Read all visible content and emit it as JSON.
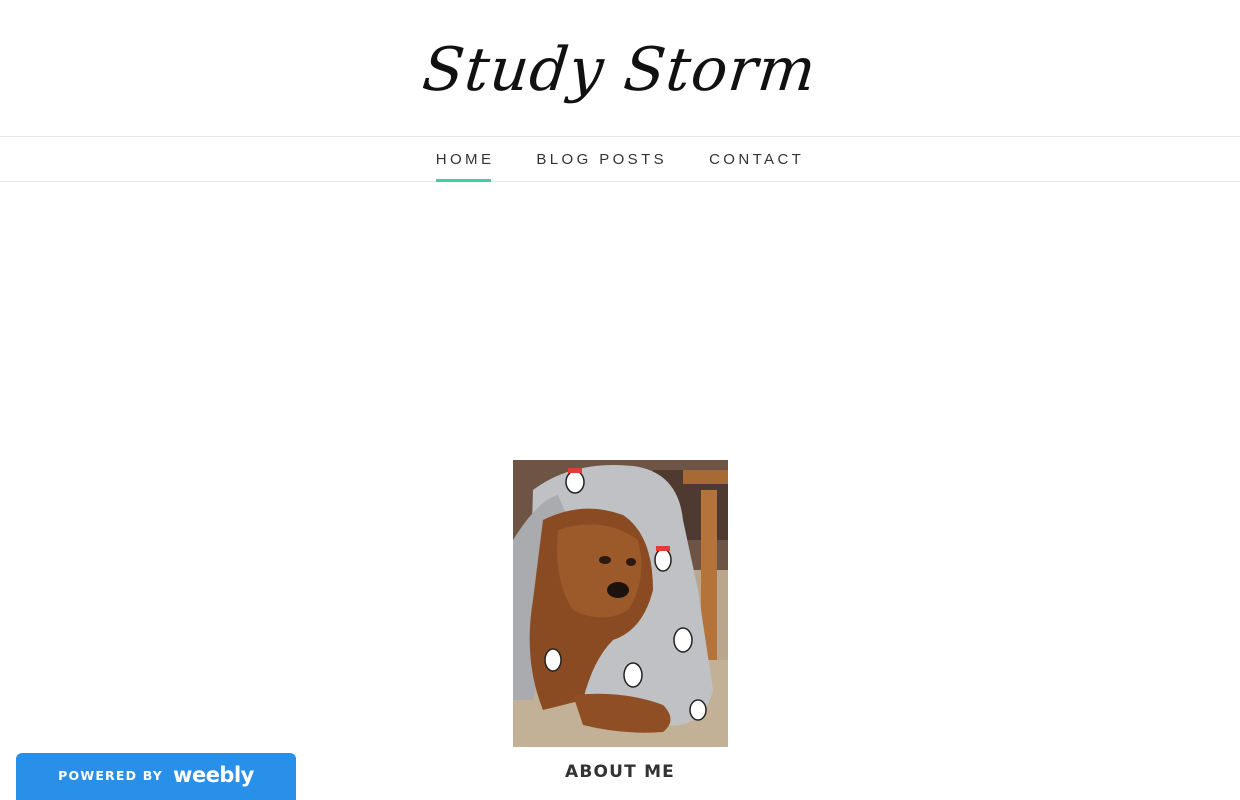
{
  "site": {
    "title": "Study Storm"
  },
  "nav": {
    "items": [
      {
        "label": "HOME",
        "active": true
      },
      {
        "label": "BLOG POSTS",
        "active": false
      },
      {
        "label": "CONTACT",
        "active": false
      }
    ],
    "active_underline_color": "#3fd0a0"
  },
  "main": {
    "photo_icon": "dog-photo",
    "about_heading": "ABOUT ME"
  },
  "badge": {
    "powered_by": "POWERED BY",
    "brand": "weebly",
    "color": "#2990ea"
  }
}
